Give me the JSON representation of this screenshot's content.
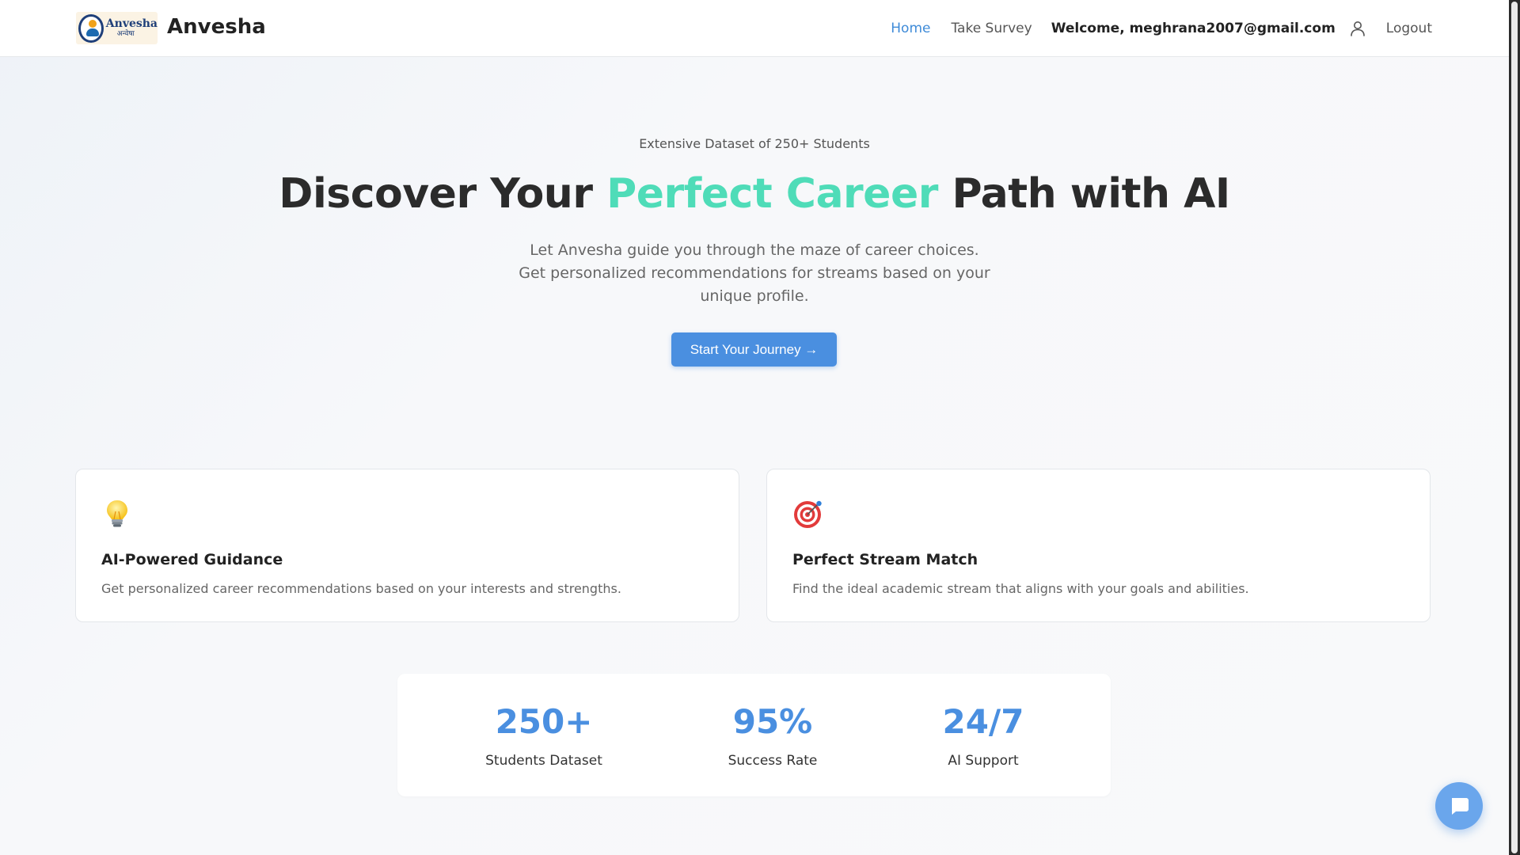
{
  "header": {
    "logo_text": "Anvesha",
    "logo_subtext": "अन्वेषा",
    "brand": "Anvesha",
    "nav": {
      "home": "Home",
      "take_survey": "Take Survey",
      "welcome": "Welcome, meghrana2007@gmail.com",
      "logout": "Logout"
    }
  },
  "hero": {
    "eyebrow": "Extensive Dataset of 250+ Students",
    "headline_part1": "Discover Your ",
    "headline_accent": "Perfect Career",
    "headline_part2": " Path with AI",
    "subtitle": "Let Anvesha guide you through the maze of career choices. Get personalized recommendations for streams based on your unique profile.",
    "cta": "Start Your Journey →"
  },
  "features": [
    {
      "icon": "lightbulb-icon",
      "title": "AI-Powered Guidance",
      "description": "Get personalized career recommendations based on your interests and strengths."
    },
    {
      "icon": "target-icon",
      "title": "Perfect Stream Match",
      "description": "Find the ideal academic stream that aligns with your goals and abilities."
    }
  ],
  "stats": [
    {
      "value": "250+",
      "label": "Students Dataset"
    },
    {
      "value": "95%",
      "label": "Success Rate"
    },
    {
      "value": "24/7",
      "label": "AI Support"
    }
  ],
  "colors": {
    "primary": "#4a8fe0",
    "accent": "#4fdcb8",
    "nav_active": "#3f8bd8",
    "text_dark": "#2b2b2b"
  }
}
